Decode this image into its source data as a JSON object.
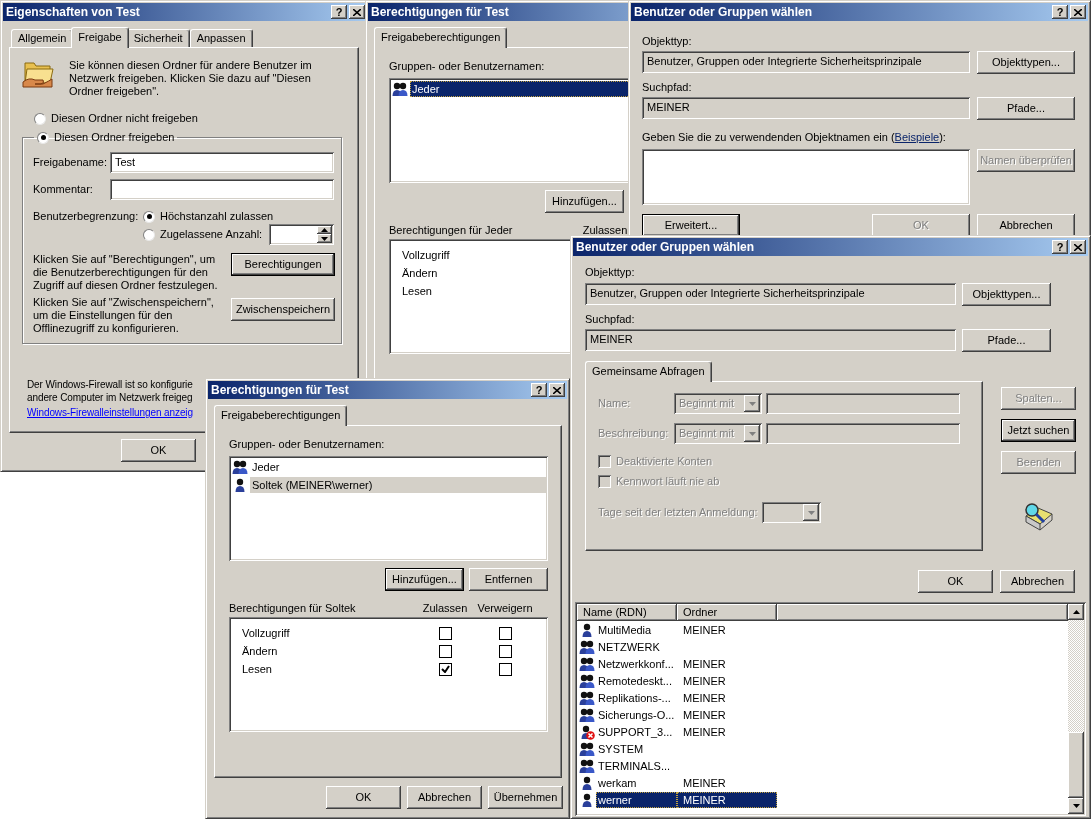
{
  "windows": [
    {
      "kind": "properties",
      "title": "Eigenschaften von Test",
      "help_button": "?",
      "tabs": [
        {
          "label": "Allgemein",
          "selected": false
        },
        {
          "label": "Freigabe",
          "selected": true
        },
        {
          "label": "Sicherheit",
          "selected": false
        },
        {
          "label": "Anpassen",
          "selected": false
        }
      ],
      "intro": "Sie können diesen Ordner für andere Benutzer im Netzwerk freigeben. Klicken Sie dazu auf \"Diesen Ordner freigeben\".",
      "share_options": [
        {
          "label": "Diesen Ordner nicht freigeben",
          "selected": false
        },
        {
          "label": "Diesen Ordner freigeben",
          "selected": true
        }
      ],
      "share_name": {
        "label": "Freigabename:",
        "value": "Test"
      },
      "comment": {
        "label": "Kommentar:"
      },
      "user_limit": {
        "label": "Benutzerbegrenzung:",
        "options": [
          {
            "label": "Höchstanzahl zulassen",
            "selected": true
          },
          {
            "label": "Zugelassene Anzahl:",
            "selected": false
          }
        ]
      },
      "permissions_text": "Klicken Sie auf \"Berechtigungen\", um die Benutzerberechtigungen für den Zugriff auf diesen Ordner festzulegen.",
      "permissions_button": {
        "label": "Berechtigungen",
        "disabled": false,
        "default": true
      },
      "caching_text": "Klicken Sie auf \"Zwischenspeichern\", um die Einstellungen für den Offlinezugriff zu konfigurieren.",
      "caching_button": {
        "label": "Zwischenspeichern",
        "disabled": false,
        "default": false
      },
      "firewall_note": [
        "Der Windows-Firewall ist so konfigurie",
        "andere Computer im Netzwerk freigeg"
      ],
      "firewall_link": "Windows-Firewalleinstellungen anzeig",
      "buttons": [
        {
          "label": "OK",
          "disabled": false,
          "default": false
        }
      ]
    },
    {
      "kind": "share_permissions",
      "title": "Berechtigungen für Test",
      "tabs": [
        {
          "label": "Freigabeberechtigungen",
          "selected": true
        }
      ],
      "names_label": "Gruppen- oder Benutzernamen:",
      "names_focused": true,
      "names": [
        {
          "name": "Jeder",
          "kind": "group",
          "selected": true
        }
      ],
      "list_buttons": [
        {
          "label": "Hinzufügen...",
          "disabled": false,
          "default": false
        }
      ],
      "permissions_label": "Berechtigungen für Jeder",
      "columns": [
        "Zulassen"
      ],
      "permissions": [
        {
          "name": "Vollzugriff"
        },
        {
          "name": "Ändern"
        },
        {
          "name": "Lesen"
        }
      ]
    },
    {
      "kind": "select_users",
      "title": "Benutzer oder Gruppen wählen",
      "help_button": "?",
      "object_type": {
        "label": "Objekttyp:",
        "value": "Benutzer, Gruppen oder Integrierte Sicherheitsprinzipale",
        "button": {
          "label": "Objekttypen...",
          "disabled": false,
          "default": false
        }
      },
      "search_path": {
        "label": "Suchpfad:",
        "value": "MEINER",
        "button": {
          "label": "Pfade...",
          "disabled": false,
          "default": false
        }
      },
      "names_prompt": {
        "before": "Geben Sie die zu verwendenden Objektnamen ein (",
        "link": "Beispiele",
        "after": "):"
      },
      "check_button": {
        "label": "Namen überprüfen",
        "disabled": true,
        "default": false
      },
      "advanced_button": {
        "label": "Erweitert...",
        "disabled": false,
        "default": true
      },
      "buttons": [
        {
          "label": "OK",
          "disabled": true,
          "default": false
        },
        {
          "label": "Abbrechen",
          "disabled": false,
          "default": false
        }
      ]
    },
    {
      "kind": "share_permissions",
      "title": "Berechtigungen für Test",
      "help_button": "?",
      "tabs": [
        {
          "label": "Freigabeberechtigungen",
          "selected": true
        }
      ],
      "names_label": "Gruppen- oder Benutzernamen:",
      "names_focused": false,
      "names": [
        {
          "name": "Jeder",
          "kind": "group",
          "selected": false
        },
        {
          "name": "Soltek (MEINER\\werner)",
          "kind": "user",
          "selected": true
        }
      ],
      "list_buttons": [
        {
          "label": "Hinzufügen...",
          "disabled": false,
          "default": true
        },
        {
          "label": "Entfernen",
          "disabled": false,
          "default": false
        }
      ],
      "permissions_label": "Berechtigungen für Soltek",
      "columns": [
        "Zulassen",
        "Verweigern"
      ],
      "permissions": [
        {
          "name": "Vollzugriff",
          "allow": false,
          "deny": false
        },
        {
          "name": "Ändern",
          "allow": false,
          "deny": false
        },
        {
          "name": "Lesen",
          "allow": true,
          "deny": false
        }
      ],
      "buttons": [
        {
          "label": "OK",
          "disabled": false,
          "default": false
        },
        {
          "label": "Abbrechen",
          "disabled": false,
          "default": false
        },
        {
          "label": "Übernehmen",
          "disabled": false,
          "default": false
        }
      ]
    },
    {
      "kind": "select_users_advanced",
      "title": "Benutzer oder Gruppen wählen",
      "help_button": "?",
      "object_type": {
        "label": "Objekttyp:",
        "value": "Benutzer, Gruppen oder Integrierte Sicherheitsprinzipale",
        "button": {
          "label": "Objekttypen...",
          "disabled": false,
          "default": false
        }
      },
      "search_path": {
        "label": "Suchpfad:",
        "value": "MEINER",
        "button": {
          "label": "Pfade...",
          "disabled": false,
          "default": false
        }
      },
      "query_tabs": [
        {
          "label": "Gemeinsame Abfragen",
          "selected": true
        }
      ],
      "query_fields": [
        {
          "label": "Name:",
          "operator": "Beginnt mit",
          "disabled": true
        },
        {
          "label": "Beschreibung:",
          "operator": "Beginnt mit",
          "disabled": true
        }
      ],
      "query_checks": [
        {
          "label": "Deaktivierte Konten",
          "checked": false,
          "disabled": true
        },
        {
          "label": "Kennwort läuft nie ab",
          "checked": false,
          "disabled": true
        }
      ],
      "days": {
        "label": "Tage seit der letzten Anmeldung:",
        "disabled": true
      },
      "side_buttons": [
        {
          "label": "Spalten...",
          "disabled": true,
          "default": false
        },
        {
          "label": "Jetzt suchen",
          "disabled": false,
          "default": true
        },
        {
          "label": "Beenden",
          "disabled": true,
          "default": false
        }
      ],
      "buttons": [
        {
          "label": "OK",
          "disabled": false,
          "default": false
        },
        {
          "label": "Abbrechen",
          "disabled": false,
          "default": false
        }
      ],
      "results": {
        "columns": [
          "Name (RDN)",
          "Ordner"
        ],
        "rows": [
          {
            "name": "MultiMedia",
            "folder": "MEINER",
            "kind": "user",
            "selected": false
          },
          {
            "name": "NETZWERK",
            "kind": "group",
            "selected": false
          },
          {
            "name": "Netzwerkkonf...",
            "folder": "MEINER",
            "kind": "group",
            "selected": false
          },
          {
            "name": "Remotedeskt...",
            "folder": "MEINER",
            "kind": "group",
            "selected": false
          },
          {
            "name": "Replikations-...",
            "folder": "MEINER",
            "kind": "group",
            "selected": false
          },
          {
            "name": "Sicherungs-O...",
            "folder": "MEINER",
            "kind": "group",
            "selected": false
          },
          {
            "name": "SUPPORT_3...",
            "folder": "MEINER",
            "kind": "disabled_user",
            "selected": false
          },
          {
            "name": "SYSTEM",
            "kind": "group",
            "selected": false
          },
          {
            "name": "TERMINALS...",
            "kind": "group",
            "selected": false
          },
          {
            "name": "werkam",
            "folder": "MEINER",
            "kind": "user",
            "selected": false
          },
          {
            "name": "werner",
            "folder": "MEINER",
            "kind": "user",
            "selected": true
          }
        ]
      }
    }
  ]
}
